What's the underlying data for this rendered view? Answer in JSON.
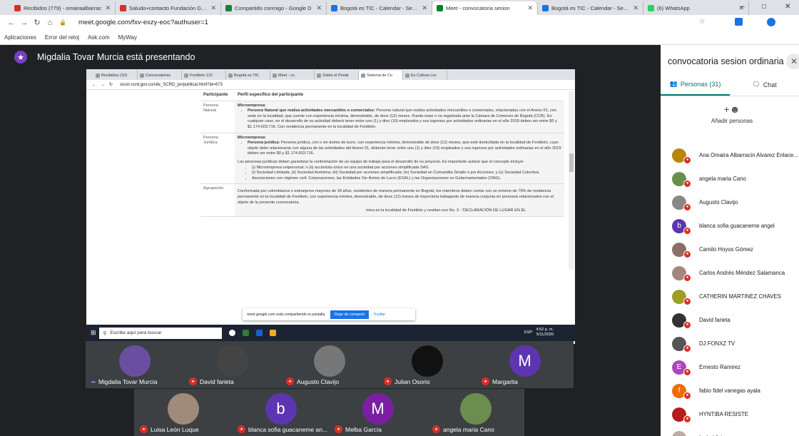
{
  "browser_tabs": [
    {
      "label": "Recibidos (779) - omairaalbarrac",
      "color": "#d93025"
    },
    {
      "label": "Saludo+contacto Fundación Grac",
      "color": "#d93025"
    },
    {
      "label": "Compartido conmigo - Google D",
      "color": "#188038"
    },
    {
      "label": "Bogotá es TIC - Calendar - Sema",
      "color": "#1a73e8"
    },
    {
      "label": "Meet - convocatoria sesion",
      "color": "#00832d",
      "active": true
    },
    {
      "label": "Bogotá es TIC - Calendar - Sema",
      "color": "#1a73e8"
    },
    {
      "label": "(6) WhatsApp",
      "color": "#25d366"
    }
  ],
  "address": {
    "url": "meet.google.com/fxv-exzy-eoc?authuser=1"
  },
  "bookmarks": [
    "Aplicaciones",
    "Error del reloj",
    "Ask.com",
    "MyWay"
  ],
  "presenter": {
    "text": "Migdalia Tovar Murcia está presentando"
  },
  "shared_screen": {
    "tabs": [
      "Recibidos (115",
      "Convocatorias",
      "Fontibón 112:",
      "Bogotá es TIC",
      "Meet - co",
      "Sobre el Portal",
      "Sistema de Co",
      "Es Cultura Loc"
    ],
    "url": "sicon.scrd.gov.co/site_SCRD_pv/publicar.html?id=673",
    "table": {
      "headers": [
        "Participante",
        "Perfil específico del participante"
      ],
      "rows": [
        {
          "participant": "Persona Natural",
          "heading": "Microempresa:",
          "bullets": [
            {
              "bold": "Persona Natural que realiza actividades mercantiles o comerciales:",
              "text": " Persona natural que realiza actividades mercantiles o comerciales, relacionadas con el Anexo 01, con sede en la localidad, que cuente con experiencia mínima, demostrable, de doce (12) meses. Puede estar o no registrada ante la Cámara de Comercio de Bogotá (CCB). En cualquier caso, en el desarrollo de su actividad deberá tener entre uno (1) y diez (10) empleados y sus ingresos por actividades ordinarias en el año 2019 deben ser entre $0 y $1.174.603.716. Con residencia permanente en la localidad de Fontibón."
            }
          ]
        },
        {
          "participant": "Persona Jurídica",
          "heading": "Microempresa:",
          "bullets": [
            {
              "bold": "Persona jurídica:",
              "text": " Persona jurídica, con o sin ánimo de lucro, con experiencia mínima, demostrable de doce (12) meses, que esté domiciliada en la localidad de Fontibón, cuyo objeto debe relacionarse con alguna de las actividades del Anexo 01, deberán tener entre uno (1) y diez (10) empleados y sus ingresos por actividades ordinarias en el año 2019 deben ser entre $0 y $1.174.603.716."
            }
          ],
          "para": "Las personas jurídicas deben garantizar la conformación de un equipo de trabajo para el desarrollo de su proyecto. Es importante aclarar que el concepto incluye:",
          "sub_bullets": [
            "(i) Microempresa unipersonal; o (ii) accionista único en una sociedad por acciones simplificada SAS.",
            "(i) Sociedad Limitada; (ii) Sociedad Anónima; (iii) Sociedad por acciones simplificada; (iv) Sociedad en Comandita Simple o por Acciones; y (v) Sociedad Colectiva.",
            "Asociaciones con régimen civil: Corporaciones, las Entidades Sin Ánimo de Lucro (ESAL) y las Organizaciones no Gubernamentales (ONG)."
          ]
        },
        {
          "participant": "Agrupación",
          "para": "Conformada por colombianos o extranjeros mayores de 18 años, residentes de manera permanente en Bogotá, los miembros deben contar con un mínimo de 70% de residencia permanente en la localidad de Fontibón, con experiencia mínima, demostrable, de doce (12) meses de trayectoria trabajando de manera conjunta en procesos relacionados con el objeto de la presente convocatoria.",
          "para2": "mica en la localidad de Fontibón y residan exo No. 3 - 'DECLARACIÓN DE LUGAR EN EL"
        }
      ]
    },
    "share_banner": {
      "text": "meet.google.com está compartiendo tu pantalla.",
      "stop": "Dejar de compartir",
      "hide": "Ocultar"
    },
    "taskbar": {
      "search": "Escribe aquí para buscar",
      "time": "4:52 p. m.",
      "date": "5/11/2020",
      "lang": "ESP"
    }
  },
  "tiles": [
    {
      "name": "Migdalia Tovar Murcia",
      "initial": "",
      "color": "#6a4fa0",
      "muted": false
    },
    {
      "name": "David farieta",
      "initial": "",
      "color": "#444",
      "muted": true
    },
    {
      "name": "Augusto Clavijo",
      "initial": "",
      "color": "#777",
      "muted": true
    },
    {
      "name": "Julian Osorio",
      "initial": "",
      "color": "#111",
      "muted": true
    },
    {
      "name": "Margarita",
      "initial": "M",
      "color": "#5e35b1",
      "muted": true
    },
    {
      "name": "Luisa León Luque",
      "initial": "",
      "color": "#a08a7a",
      "muted": true
    },
    {
      "name": "blanca sofia guacaneme an...",
      "initial": "b",
      "color": "#5e35b1",
      "muted": true
    },
    {
      "name": "Melba García",
      "initial": "M",
      "color": "#7b1fa2",
      "muted": true
    },
    {
      "name": "angela maria Cano",
      "initial": "",
      "color": "#6b8e4e",
      "muted": true
    }
  ],
  "panel": {
    "title": "convocatoria sesion ordinaria CL...",
    "people_tab": "Personas (31)",
    "chat_tab": "Chat",
    "add_people": "Añadir personas",
    "participants": [
      {
        "name": "Ana Omaira Albarracin Alvarez Enlace...",
        "initial": "",
        "color": "#b8860b"
      },
      {
        "name": "angela maria Cano",
        "initial": "",
        "color": "#6b8e4e"
      },
      {
        "name": "Augusto Clavijo",
        "initial": "",
        "color": "#888"
      },
      {
        "name": "blanca sofia guacaneme angel",
        "initial": "b",
        "color": "#5e35b1"
      },
      {
        "name": "Camilo Hoyos Gómez",
        "initial": "",
        "color": "#8d6e63"
      },
      {
        "name": "Carlos Andrés Méndez Salamanca",
        "initial": "",
        "color": "#a1887f"
      },
      {
        "name": "CATHERIN MARTINEZ CHAVES",
        "initial": "",
        "color": "#9e9d24"
      },
      {
        "name": "David farieta",
        "initial": "",
        "color": "#333"
      },
      {
        "name": "DJ FONXZ TV",
        "initial": "",
        "color": "#555"
      },
      {
        "name": "Ernesto Ramirez",
        "initial": "E",
        "color": "#ab47bc"
      },
      {
        "name": "fabio fidel vanegas ayala",
        "initial": "f",
        "color": "#ef6c00"
      },
      {
        "name": "HYNTIBA RESISTE",
        "initial": "",
        "color": "#b71c1c"
      },
      {
        "name": "Isabel Arias",
        "initial": "",
        "color": "#bcaaa4"
      }
    ]
  }
}
